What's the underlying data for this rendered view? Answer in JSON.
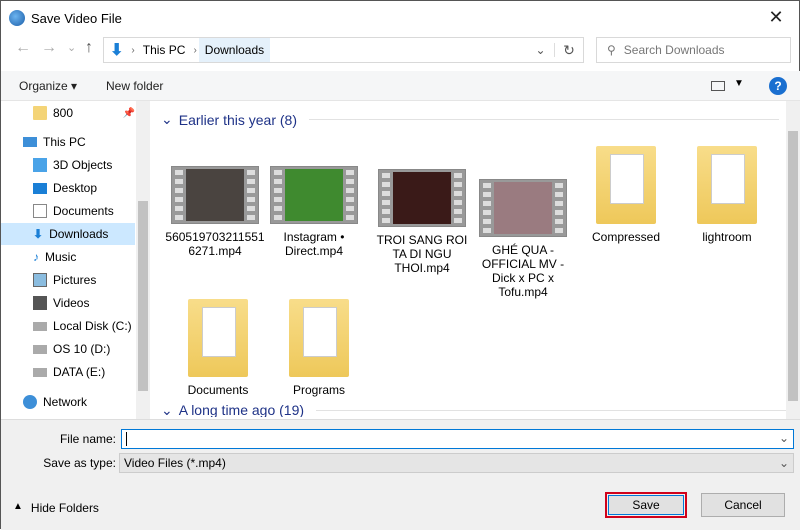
{
  "window": {
    "title": "Save Video File",
    "close": "✕"
  },
  "nav": {
    "back": "←",
    "forward": "→",
    "recent": "⌄",
    "up": "↑",
    "crumbs": [
      "This PC",
      "Downloads"
    ],
    "refresh": "↻",
    "dropdown": "⌄",
    "search_placeholder": "Search Downloads"
  },
  "toolbar": {
    "organize": "Organize ▾",
    "new_folder": "New folder",
    "help": "?"
  },
  "sidebar": {
    "items": [
      {
        "label": "800",
        "icon": "folder-icon"
      },
      {
        "label": "This PC",
        "icon": "computer-icon"
      },
      {
        "label": "3D Objects",
        "icon": "cube-icon"
      },
      {
        "label": "Desktop",
        "icon": "desktop-icon"
      },
      {
        "label": "Documents",
        "icon": "document-icon"
      },
      {
        "label": "Downloads",
        "icon": "download-icon"
      },
      {
        "label": "Music",
        "icon": "music-icon"
      },
      {
        "label": "Pictures",
        "icon": "picture-icon"
      },
      {
        "label": "Videos",
        "icon": "video-icon"
      },
      {
        "label": "Local Disk (C:)",
        "icon": "drive-icon"
      },
      {
        "label": "OS 10 (D:)",
        "icon": "drive-icon"
      },
      {
        "label": "DATA (E:)",
        "icon": "drive-icon"
      },
      {
        "label": "Network",
        "icon": "network-icon"
      }
    ]
  },
  "groups": {
    "earlier": "Earlier this year (8)",
    "long_ago": "A long time ago (19)"
  },
  "files": [
    {
      "name": "5605197032115516271.mp4",
      "lines": [
        "560519703211551",
        "6271.mp4"
      ],
      "type": "video",
      "color": "#4a4440"
    },
    {
      "name": "Instagram • Direct.mp4",
      "lines": [
        "Instagram •",
        "Direct.mp4"
      ],
      "type": "video",
      "color": "#3f8a2f"
    },
    {
      "name": "TROI SANG ROI TA DI NGU THOI.mp4",
      "lines": [
        "TROI SANG ROI",
        "TA DI NGU",
        "THOI.mp4"
      ],
      "type": "video",
      "color": "#3a1a18"
    },
    {
      "name": "GHÉ QUA - OFFICIAL MV - Dick x PC x Tofu.mp4",
      "lines": [
        "GHÉ QUA -",
        "OFFICIAL MV -",
        "Dick x PC x",
        "Tofu.mp4"
      ],
      "type": "video",
      "color": "#9a7b80"
    },
    {
      "name": "Compressed",
      "lines": [
        "Compressed"
      ],
      "type": "folder"
    },
    {
      "name": "lightroom",
      "lines": [
        "lightroom"
      ],
      "type": "folder"
    },
    {
      "name": "Documents",
      "lines": [
        "Documents"
      ],
      "type": "folder"
    },
    {
      "name": "Programs",
      "lines": [
        "Programs"
      ],
      "type": "folder"
    }
  ],
  "form": {
    "file_name_label": "File name:",
    "file_name_value": "",
    "save_type_label": "Save as type:",
    "save_type_value": "Video Files (*.mp4)"
  },
  "footer": {
    "hide_folders": "Hide Folders",
    "save": "Save",
    "cancel": "Cancel",
    "highlight_color": "#d0021b"
  }
}
